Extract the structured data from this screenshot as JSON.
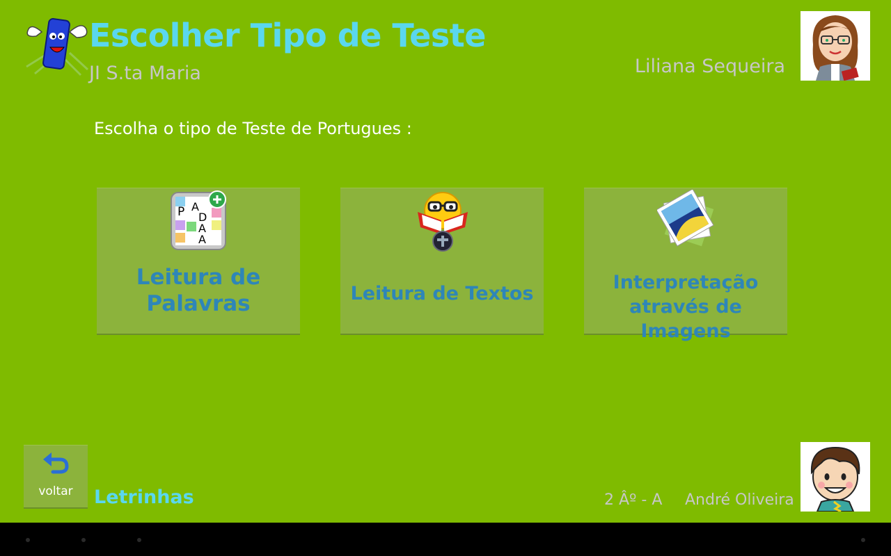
{
  "header": {
    "title": "Escolher Tipo de Teste",
    "school": "JI S.ta Maria",
    "teacher_name": "Liliana Sequeira"
  },
  "main": {
    "instruction": "Escolha o tipo de Teste de Portugues :",
    "tiles": [
      {
        "label_lines": [
          "Leitura de",
          "Palavras"
        ],
        "icon": "word-puzzle-icon"
      },
      {
        "label_lines": [
          "Leitura de Textos"
        ],
        "icon": "reading-smiley-icon"
      },
      {
        "label_lines": [
          "Interpretação",
          "através de Imagens"
        ],
        "icon": "photos-icon"
      }
    ]
  },
  "footer": {
    "back_label": "voltar",
    "app_name": "Letrinhas",
    "class_label": "2 Âº - A",
    "student_name": "André Oliveira"
  },
  "colors": {
    "background": "#7fbb00",
    "title": "#5ad7ef",
    "tile_bg": "#8cb33c",
    "tile_text": "#2e86b8",
    "muted_text": "#c7c7c7"
  }
}
